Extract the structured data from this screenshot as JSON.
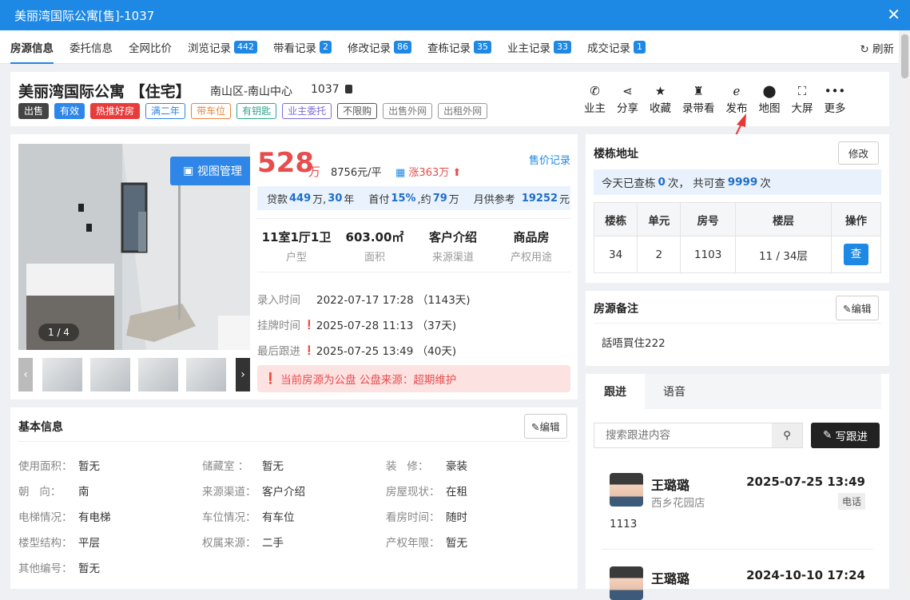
{
  "window": {
    "title": "美丽湾国际公寓[售]-1037"
  },
  "tabs": [
    {
      "label": "房源信息",
      "count": null,
      "active": true
    },
    {
      "label": "委托信息",
      "count": null
    },
    {
      "label": "全网比价",
      "count": null
    },
    {
      "label": "浏览记录",
      "count": "442"
    },
    {
      "label": "带看记录",
      "count": "2"
    },
    {
      "label": "修改记录",
      "count": "86"
    },
    {
      "label": "查栋记录",
      "count": "35"
    },
    {
      "label": "业主记录",
      "count": "33"
    },
    {
      "label": "成交记录",
      "count": "1"
    }
  ],
  "refresh_label": "刷新",
  "header": {
    "name": "美丽湾国际公寓 【住宅】",
    "area": "南山区-南山中心",
    "code": "1037",
    "tags": [
      {
        "text": "出售",
        "bg": "#444",
        "fg": "#fff",
        "bd": "#444"
      },
      {
        "text": "有效",
        "bg": "#2e86e8",
        "fg": "#fff",
        "bd": "#2e86e8"
      },
      {
        "text": "热推好房",
        "bg": "#e83c3c",
        "fg": "#fff",
        "bd": "#e83c3c"
      },
      {
        "text": "满二年",
        "bg": "#fff",
        "fg": "#2e86e8",
        "bd": "#2e86e8"
      },
      {
        "text": "带车位",
        "bg": "#fff",
        "fg": "#e8853c",
        "bd": "#e8853c"
      },
      {
        "text": "有钥匙",
        "bg": "#fff",
        "fg": "#2aa58a",
        "bd": "#2aa58a"
      },
      {
        "text": "业主委托",
        "bg": "#fff",
        "fg": "#7a6ad8",
        "bd": "#7a6ad8"
      },
      {
        "text": "不限购",
        "bg": "#fff",
        "fg": "#555",
        "bd": "#555"
      },
      {
        "text": "出售外网",
        "bg": "#fff",
        "fg": "#777",
        "bd": "#999"
      },
      {
        "text": "出租外网",
        "bg": "#fff",
        "fg": "#777",
        "bd": "#999"
      }
    ],
    "actions": [
      {
        "label": "业主",
        "icon": "phone-icon",
        "glyph": "✆"
      },
      {
        "label": "分享",
        "icon": "share-icon",
        "glyph": "⋖"
      },
      {
        "label": "收藏",
        "icon": "star-icon",
        "glyph": "★"
      },
      {
        "label": "录带看",
        "icon": "record-icon",
        "glyph": "♜"
      },
      {
        "label": "发布",
        "icon": "publish-icon",
        "glyph": "ℯ"
      },
      {
        "label": "地图",
        "icon": "map-pin-icon",
        "glyph": "⬤"
      },
      {
        "label": "大屏",
        "icon": "fullscreen-icon",
        "glyph": "⛶"
      },
      {
        "label": "更多",
        "icon": "more-icon",
        "glyph": "•••"
      }
    ]
  },
  "main": {
    "view_btn": "视图管理",
    "counter": "1 / 4",
    "price": "528",
    "price_unit": "万",
    "per_price": "8756元/平",
    "rise": "涨363万",
    "price_record": "售价记录",
    "loan": {
      "l1": "贷款",
      "v1": "449",
      "u1": "万,",
      "v2": "30",
      "u2": "年",
      "l2": "首付",
      "v3": "15%",
      "u3": ",约",
      "v4": "79",
      "u4": "万",
      "l3": "月供参考",
      "v5": "19252",
      "u5": "元"
    },
    "stats": [
      {
        "v": "11室1厅1卫",
        "k": "户型"
      },
      {
        "v": "603.00㎡",
        "k": "面积"
      },
      {
        "v": "客户介绍",
        "k": "来源渠道"
      },
      {
        "v": "商品房",
        "k": "产权用途"
      }
    ],
    "times": [
      {
        "k": "录入时间",
        "v": "2022-07-17 17:28 （1143天)"
      },
      {
        "k": "挂牌时间",
        "v": "2025-07-28 11:13 （37天)"
      },
      {
        "k": "最后跟进",
        "v": "2025-07-25 13:49 （40天)"
      }
    ],
    "alert": "当前房源为公盘  公盘来源：超期维护"
  },
  "basic": {
    "title": "基本信息",
    "edit": "编辑",
    "rows": [
      [
        {
          "k": "使用面积：",
          "v": "暂无"
        },
        {
          "k": "储藏室 ：",
          "v": "暂无"
        },
        {
          "k": "装   修：",
          "v": "豪装"
        }
      ],
      [
        {
          "k": "朝   向：",
          "v": "南"
        },
        {
          "k": "来源渠道：",
          "v": "客户介绍"
        },
        {
          "k": "房屋现状：",
          "v": "在租"
        }
      ],
      [
        {
          "k": "电梯情况：",
          "v": "有电梯"
        },
        {
          "k": "车位情况：",
          "v": "有车位"
        },
        {
          "k": "看房时间：",
          "v": "随时"
        }
      ],
      [
        {
          "k": "楼型结构：",
          "v": "平层"
        },
        {
          "k": "权属来源：",
          "v": "二手"
        },
        {
          "k": "产权年限：",
          "v": "暂无"
        }
      ],
      [
        {
          "k": "其他编号：",
          "v": "暂无"
        }
      ]
    ]
  },
  "location": {
    "title": "楼栋地址",
    "edit": "修改",
    "q_prefix": "今天已查栋",
    "q_today": "0",
    "q_mid": "次， 共可查",
    "q_total": "9999",
    "q_suffix": "次",
    "headers": [
      "楼栋",
      "单元",
      "房号",
      "楼层",
      "操作"
    ],
    "row": [
      "34",
      "2",
      "1103",
      "11 / 34层"
    ],
    "query_btn": "查"
  },
  "note": {
    "title": "房源备注",
    "edit": "编辑",
    "content": "話唔買住222"
  },
  "follow": {
    "tabs": [
      "跟进",
      "语音"
    ],
    "search_placeholder": "搜索跟进内容",
    "write": "写跟进",
    "entries": [
      {
        "name": "王璐璐",
        "date": "2025-07-25 13:49",
        "shop": "西乡花园店",
        "badge": "电话",
        "content": "1113"
      },
      {
        "name": "王璐璐",
        "date": "2024-10-10 17:24",
        "shop": "",
        "badge": "",
        "content": ""
      }
    ]
  }
}
